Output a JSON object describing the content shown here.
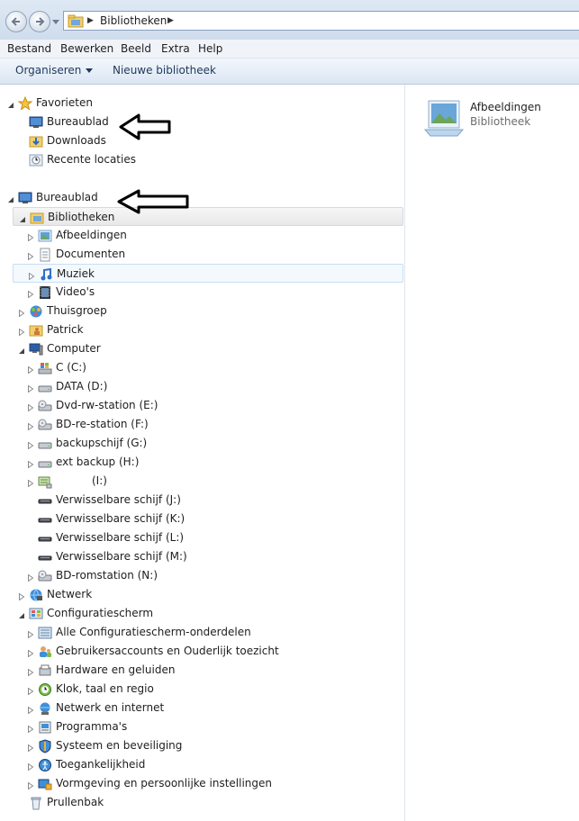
{
  "address": {
    "crumb": "Bibliotheken"
  },
  "menu": [
    "Bestand",
    "Bewerken",
    "Beeld",
    "Extra",
    "Help"
  ],
  "toolbar": {
    "organize": "Organiseren",
    "new_library": "Nieuwe bibliotheek"
  },
  "tree": [
    {
      "label": "Favorieten",
      "icon": "star-icon",
      "level": 0,
      "expand": "open"
    },
    {
      "label": "Bureaublad",
      "icon": "desktop-icon",
      "level": 1,
      "expand": "none"
    },
    {
      "label": "Downloads",
      "icon": "downloads-folder-icon",
      "level": 1,
      "expand": "none"
    },
    {
      "label": "Recente locaties",
      "icon": "recent-places-icon",
      "level": 1,
      "expand": "none"
    },
    {
      "label": "",
      "icon": "",
      "level": 0,
      "expand": "spacer"
    },
    {
      "label": "Bureaublad",
      "icon": "desktop-icon",
      "level": 0,
      "expand": "open"
    },
    {
      "label": "Bibliotheken",
      "icon": "libraries-icon",
      "level": 1,
      "expand": "open",
      "state": "selected"
    },
    {
      "label": "Afbeeldingen",
      "icon": "pictures-icon",
      "level": 2,
      "expand": "closed"
    },
    {
      "label": "Documenten",
      "icon": "documents-icon",
      "level": 2,
      "expand": "closed"
    },
    {
      "label": "Muziek",
      "icon": "music-icon",
      "level": 2,
      "expand": "closed",
      "state": "hover"
    },
    {
      "label": "Video's",
      "icon": "videos-icon",
      "level": 2,
      "expand": "closed"
    },
    {
      "label": "Thuisgroep",
      "icon": "homegroup-icon",
      "level": 1,
      "expand": "closed"
    },
    {
      "label": "Patrick",
      "icon": "user-folder-icon",
      "level": 1,
      "expand": "closed"
    },
    {
      "label": "Computer",
      "icon": "computer-icon",
      "level": 1,
      "expand": "open"
    },
    {
      "label": "C (C:)",
      "icon": "windows-drive-icon",
      "level": 2,
      "expand": "closed"
    },
    {
      "label": "DATA (D:)",
      "icon": "hard-drive-icon",
      "level": 2,
      "expand": "closed"
    },
    {
      "label": "Dvd-rw-station (E:)",
      "icon": "optical-drive-icon",
      "level": 2,
      "expand": "closed"
    },
    {
      "label": "BD-re-station (F:)",
      "icon": "optical-drive-icon",
      "level": 2,
      "expand": "closed"
    },
    {
      "label": "backupschijf (G:)",
      "icon": "hard-drive-icon",
      "level": 2,
      "expand": "closed"
    },
    {
      "label": "ext backup (H:)",
      "icon": "hard-drive-icon",
      "level": 2,
      "expand": "closed"
    },
    {
      "label": "(I:)",
      "icon": "network-drive-icon",
      "level": 2,
      "expand": "closed",
      "indent_label": true
    },
    {
      "label": "Verwisselbare schijf (J:)",
      "icon": "removable-drive-icon",
      "level": 2,
      "expand": "none"
    },
    {
      "label": "Verwisselbare schijf (K:)",
      "icon": "removable-drive-icon",
      "level": 2,
      "expand": "none"
    },
    {
      "label": "Verwisselbare schijf (L:)",
      "icon": "removable-drive-icon",
      "level": 2,
      "expand": "none"
    },
    {
      "label": "Verwisselbare schijf (M:)",
      "icon": "removable-drive-icon",
      "level": 2,
      "expand": "none"
    },
    {
      "label": "BD-romstation (N:)",
      "icon": "optical-drive-icon",
      "level": 2,
      "expand": "closed"
    },
    {
      "label": "Netwerk",
      "icon": "network-icon",
      "level": 1,
      "expand": "closed"
    },
    {
      "label": "Configuratiescherm",
      "icon": "control-panel-icon",
      "level": 1,
      "expand": "open"
    },
    {
      "label": "Alle Configuratiescherm-onderdelen",
      "icon": "control-panel-items-icon",
      "level": 2,
      "expand": "closed"
    },
    {
      "label": "Gebruikersaccounts en Ouderlijk toezicht",
      "icon": "user-accounts-icon",
      "level": 2,
      "expand": "closed"
    },
    {
      "label": "Hardware en geluiden",
      "icon": "hardware-sound-icon",
      "level": 2,
      "expand": "closed"
    },
    {
      "label": "Klok, taal en regio",
      "icon": "clock-region-icon",
      "level": 2,
      "expand": "closed"
    },
    {
      "label": "Netwerk en internet",
      "icon": "network-internet-icon",
      "level": 2,
      "expand": "closed"
    },
    {
      "label": "Programma's",
      "icon": "programs-icon",
      "level": 2,
      "expand": "closed"
    },
    {
      "label": "Systeem en beveiliging",
      "icon": "system-security-icon",
      "level": 2,
      "expand": "closed"
    },
    {
      "label": "Toegankelijkheid",
      "icon": "accessibility-icon",
      "level": 2,
      "expand": "closed"
    },
    {
      "label": "Vormgeving en persoonlijke instellingen",
      "icon": "appearance-icon",
      "level": 2,
      "expand": "closed"
    },
    {
      "label": "Prullenbak",
      "icon": "recycle-bin-icon",
      "level": 1,
      "expand": "none"
    }
  ],
  "content": {
    "name": "Afbeeldingen",
    "type": "Bibliotheek"
  }
}
